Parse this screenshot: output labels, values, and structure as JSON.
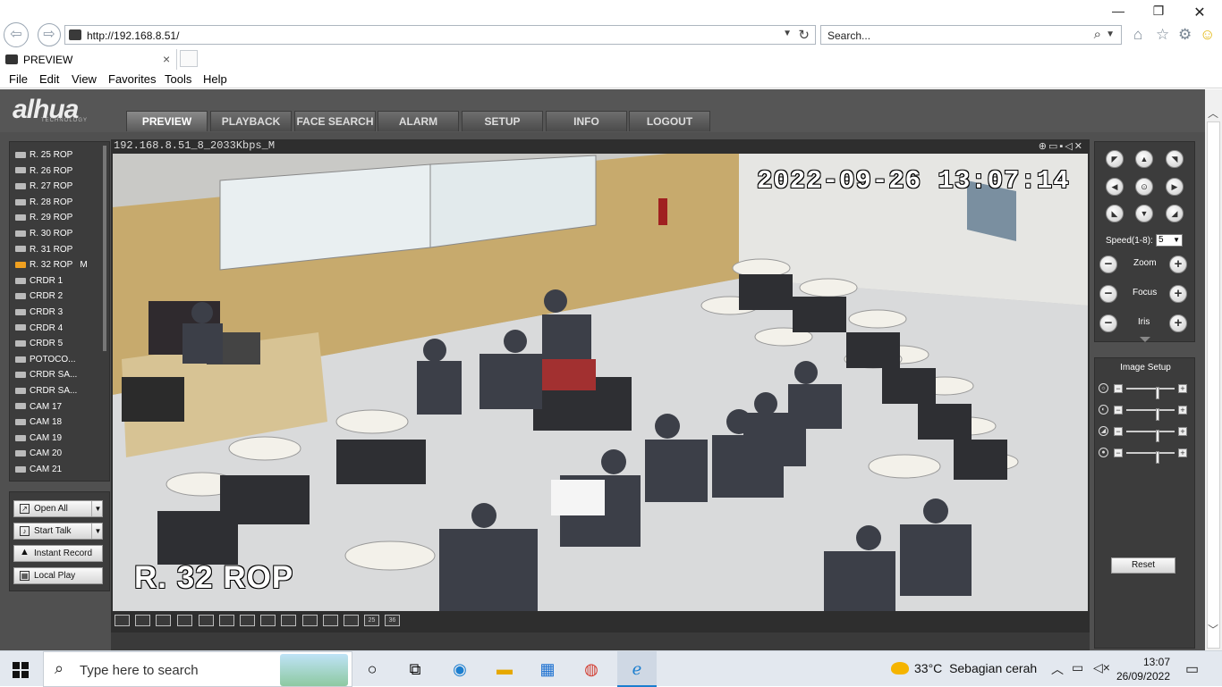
{
  "browser": {
    "url": "http://192.168.8.51/",
    "search_placeholder": "Search...",
    "tab_title": "PREVIEW",
    "menu": [
      "File",
      "Edit",
      "View",
      "Favorites",
      "Tools",
      "Help"
    ]
  },
  "app": {
    "logo": "alhua",
    "logo_sub": "TECHNOLOGY",
    "tabs": [
      "PREVIEW",
      "PLAYBACK",
      "FACE SEARCH",
      "ALARM",
      "SETUP",
      "INFO",
      "LOGOUT"
    ],
    "active_tab": "PREVIEW",
    "cameras": [
      "R. 25 ROP",
      "R. 26 ROP",
      "R. 27 ROP",
      "R. 28 ROP",
      "R. 29 ROP",
      "R. 30 ROP",
      "R. 31 ROP",
      "R. 32 ROP",
      "CRDR 1",
      "CRDR 2",
      "CRDR 3",
      "CRDR 4",
      "CRDR 5",
      "POTOCO...",
      "CRDR SA...",
      "CRDR SA...",
      "CAM 17",
      "CAM 18",
      "CAM 19",
      "CAM 20",
      "CAM 21"
    ],
    "active_camera_suffix": "M",
    "actions": {
      "open_all": "Open All",
      "start_talk": "Start Talk",
      "instant_record": "Instant Record",
      "local_play": "Local Play"
    },
    "video": {
      "stream_title": "192.168.8.51_8_2033Kbps_M",
      "osd_time": "2022-09-26 13:07:14",
      "osd_name": "R. 32 ROP",
      "layout_buttons": [
        "25",
        "36"
      ]
    },
    "ptz": {
      "speed_label": "Speed(1-8):",
      "speed_value": "5",
      "zoom_label": "Zoom",
      "focus_label": "Focus",
      "iris_label": "Iris"
    },
    "image_setup": {
      "title": "Image Setup",
      "reset_label": "Reset",
      "levels": [
        0.65,
        0.65,
        0.65,
        0.65
      ]
    }
  },
  "taskbar": {
    "search_text": "Type here to search",
    "weather_temp": "33°C",
    "weather_desc": "Sebagian cerah",
    "time": "13:07",
    "date": "26/09/2022"
  }
}
